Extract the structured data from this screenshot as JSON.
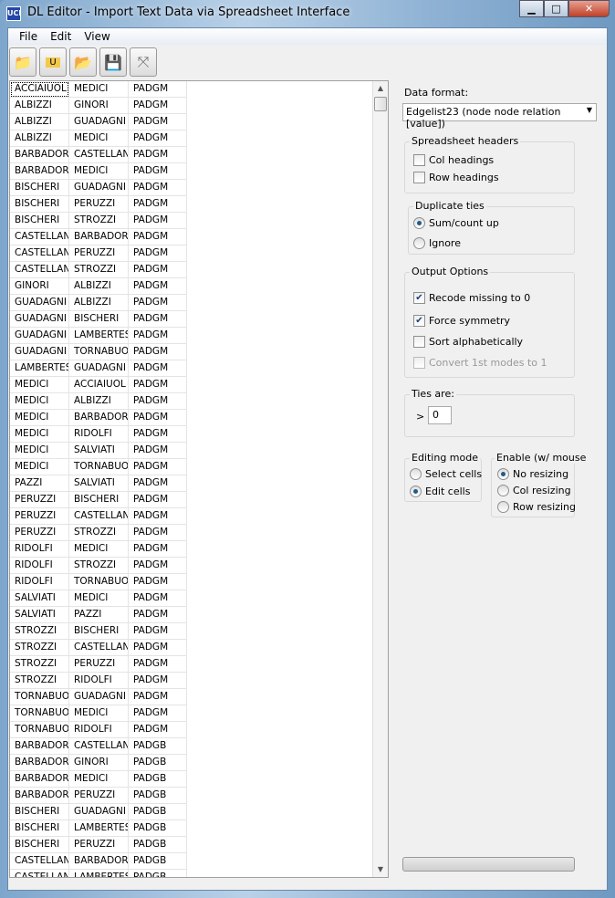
{
  "window": {
    "title": "DL Editor - Import Text Data via Spreadsheet Interface",
    "minimize": "▁",
    "maximize": "□",
    "close": "✕"
  },
  "menu": [
    "File",
    "Edit",
    "View"
  ],
  "toolbar": [
    {
      "icon": "new-folder-icon",
      "glyph": "📁"
    },
    {
      "icon": "open-u-folder-icon",
      "glyph": "U"
    },
    {
      "icon": "open-folder-icon",
      "glyph": "📂"
    },
    {
      "icon": "save-icon",
      "glyph": "💾"
    },
    {
      "icon": "compress-icon",
      "glyph": "⤧"
    }
  ],
  "grid": {
    "rows": [
      [
        "ACCIAIUOL",
        "MEDICI",
        "PADGM"
      ],
      [
        "ALBIZZI",
        "GINORI",
        "PADGM"
      ],
      [
        "ALBIZZI",
        "GUADAGNI",
        "PADGM"
      ],
      [
        "ALBIZZI",
        "MEDICI",
        "PADGM"
      ],
      [
        "BARBADORI",
        "CASTELLAN",
        "PADGM"
      ],
      [
        "BARBADORI",
        "MEDICI",
        "PADGM"
      ],
      [
        "BISCHERI",
        "GUADAGNI",
        "PADGM"
      ],
      [
        "BISCHERI",
        "PERUZZI",
        "PADGM"
      ],
      [
        "BISCHERI",
        "STROZZI",
        "PADGM"
      ],
      [
        "CASTELLAN",
        "BARBADORI",
        "PADGM"
      ],
      [
        "CASTELLAN",
        "PERUZZI",
        "PADGM"
      ],
      [
        "CASTELLAN",
        "STROZZI",
        "PADGM"
      ],
      [
        "GINORI",
        "ALBIZZI",
        "PADGM"
      ],
      [
        "GUADAGNI",
        "ALBIZZI",
        "PADGM"
      ],
      [
        "GUADAGNI",
        "BISCHERI",
        "PADGM"
      ],
      [
        "GUADAGNI",
        "LAMBERTES",
        "PADGM"
      ],
      [
        "GUADAGNI",
        "TORNABUON",
        "PADGM"
      ],
      [
        "LAMBERTES",
        "GUADAGNI",
        "PADGM"
      ],
      [
        "MEDICI",
        "ACCIAIUOL",
        "PADGM"
      ],
      [
        "MEDICI",
        "ALBIZZI",
        "PADGM"
      ],
      [
        "MEDICI",
        "BARBADORI",
        "PADGM"
      ],
      [
        "MEDICI",
        "RIDOLFI",
        "PADGM"
      ],
      [
        "MEDICI",
        "SALVIATI",
        "PADGM"
      ],
      [
        "MEDICI",
        "TORNABUON",
        "PADGM"
      ],
      [
        "PAZZI",
        "SALVIATI",
        "PADGM"
      ],
      [
        "PERUZZI",
        "BISCHERI",
        "PADGM"
      ],
      [
        "PERUZZI",
        "CASTELLAN",
        "PADGM"
      ],
      [
        "PERUZZI",
        "STROZZI",
        "PADGM"
      ],
      [
        "RIDOLFI",
        "MEDICI",
        "PADGM"
      ],
      [
        "RIDOLFI",
        "STROZZI",
        "PADGM"
      ],
      [
        "RIDOLFI",
        "TORNABUON",
        "PADGM"
      ],
      [
        "SALVIATI",
        "MEDICI",
        "PADGM"
      ],
      [
        "SALVIATI",
        "PAZZI",
        "PADGM"
      ],
      [
        "STROZZI",
        "BISCHERI",
        "PADGM"
      ],
      [
        "STROZZI",
        "CASTELLAN",
        "PADGM"
      ],
      [
        "STROZZI",
        "PERUZZI",
        "PADGM"
      ],
      [
        "STROZZI",
        "RIDOLFI",
        "PADGM"
      ],
      [
        "TORNABUON",
        "GUADAGNI",
        "PADGM"
      ],
      [
        "TORNABUON",
        "MEDICI",
        "PADGM"
      ],
      [
        "TORNABUON",
        "RIDOLFI",
        "PADGM"
      ],
      [
        "BARBADORI",
        "CASTELLAN",
        "PADGB"
      ],
      [
        "BARBADORI",
        "GINORI",
        "PADGB"
      ],
      [
        "BARBADORI",
        "MEDICI",
        "PADGB"
      ],
      [
        "BARBADORI",
        "PERUZZI",
        "PADGB"
      ],
      [
        "BISCHERI",
        "GUADAGNI",
        "PADGB"
      ],
      [
        "BISCHERI",
        "LAMBERTES",
        "PADGB"
      ],
      [
        "BISCHERI",
        "PERUZZI",
        "PADGB"
      ],
      [
        "CASTELLAN",
        "BARBADORI",
        "PADGB"
      ],
      [
        "CASTELLAN",
        "LAMBERTES",
        "PADGB"
      ]
    ]
  },
  "panel": {
    "data_format_label": "Data format:",
    "data_format_value": "Edgelist23 (node node relation [value])",
    "headers": {
      "title": "Spreadsheet headers",
      "col": "Col headings",
      "row": "Row headings",
      "col_checked": false,
      "row_checked": false
    },
    "duplicate": {
      "title": "Duplicate ties",
      "sum": "Sum/count up",
      "ignore": "Ignore",
      "selected": "sum"
    },
    "output": {
      "title": "Output Options",
      "recode": "Recode missing to 0",
      "symmetry": "Force symmetry",
      "sort": "Sort alphabetically",
      "convert": "Convert 1st modes to 1",
      "recode_checked": true,
      "symmetry_checked": true,
      "sort_checked": false,
      "convert_checked": false
    },
    "ties": {
      "title": "Ties are:",
      "op": ">",
      "value": "0"
    },
    "editing": {
      "title": "Editing mode",
      "select": "Select cells",
      "edit": "Edit cells",
      "selected": "edit"
    },
    "enable": {
      "title": "Enable (w/ mouse",
      "none": "No resizing",
      "col": "Col resizing",
      "row": "Row resizing",
      "selected": "none"
    },
    "progress": 0
  }
}
